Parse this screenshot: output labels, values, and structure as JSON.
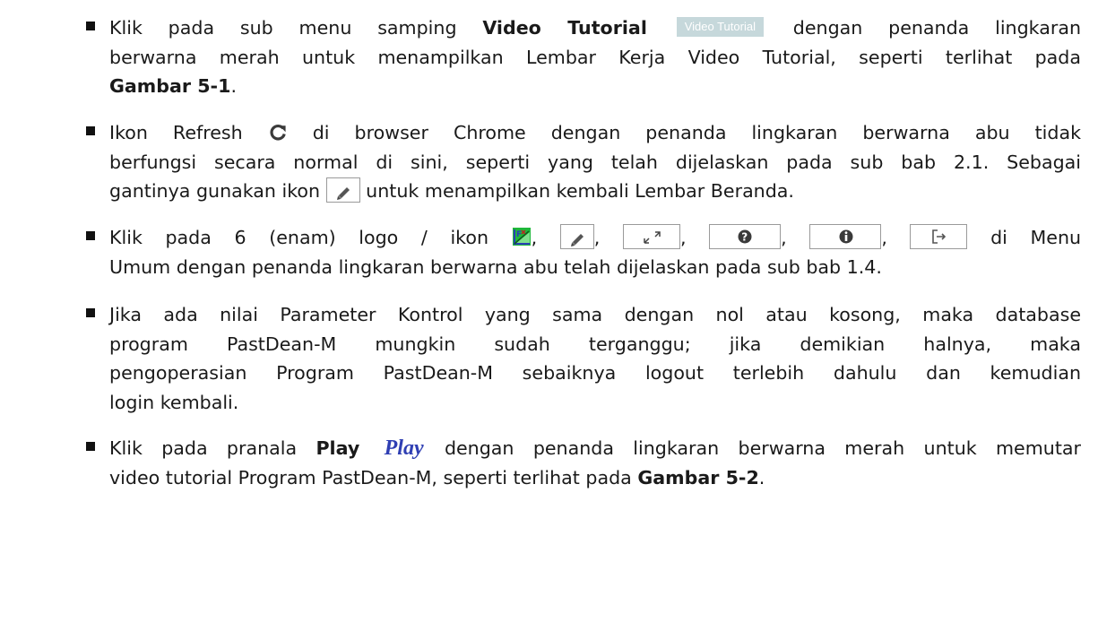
{
  "items": [
    {
      "lines": [
        [
          "Klik pada sub menu samping ",
          {
            "b": "Video Tutorial"
          },
          " ",
          {
            "vt": "video_tutorial_button"
          },
          " dengan penanda lingkaran"
        ],
        [
          "berwarna merah untuk menampilkan Lembar Kerja Video Tutorial, seperti terlihat pada"
        ],
        [
          {
            "b": "Gambar 5-1"
          },
          "."
        ]
      ]
    },
    {
      "lines": [
        [
          "Ikon Refresh ",
          {
            "icon": "refresh"
          },
          " di browser Chrome dengan penanda lingkaran berwarna abu tidak"
        ],
        [
          "berfungsi secara normal di sini, seperti yang telah dijelaskan pada sub bab 2.1.  Sebagai"
        ],
        [
          "gantinya gunakan ikon ",
          {
            "icon": "pencil"
          },
          " untuk menampilkan kembali Lembar Beranda."
        ]
      ]
    },
    {
      "lines": [
        [
          "Klik pada 6 (enam) logo / ikon ",
          {
            "icon": "logo"
          },
          ", ",
          {
            "icon": "pencil"
          },
          ", ",
          {
            "icon": "expand"
          },
          ", ",
          {
            "icon": "question"
          },
          ", ",
          {
            "icon": "info"
          },
          ", ",
          {
            "icon": "logout"
          },
          " di Menu"
        ],
        [
          "Umum  dengan penanda lingkaran berwarna abu telah dijelaskan pada sub bab 1.4."
        ]
      ]
    },
    {
      "lines": [
        [
          "Jika ada nilai Parameter Kontrol yang sama dengan nol atau kosong, maka database"
        ],
        [
          "program PastDean-M mungkin sudah terganggu; jika demikian halnya, maka"
        ],
        [
          "pengoperasian Program PastDean-M sebaiknya logout terlebih dahulu dan kemudian"
        ],
        [
          "login kembali."
        ]
      ]
    },
    {
      "lines": [
        [
          "Klik pada pranala ",
          {
            "b": "Play"
          },
          " ",
          {
            "play": "play_link"
          },
          " dengan penanda lingkaran berwarna merah untuk memutar"
        ],
        [
          "video tutorial Program PastDean-M, seperti terlihat pada ",
          {
            "b": "Gambar 5-2"
          },
          "."
        ]
      ]
    }
  ],
  "inline": {
    "video_tutorial_button": "Video Tutorial",
    "play_link": "Play"
  },
  "icons": {
    "refresh": "refresh-icon",
    "pencil": "pencil-icon",
    "logo": "logo-icon",
    "expand": "expand-icon",
    "question": "question-icon",
    "info": "info-icon",
    "logout": "logout-icon"
  },
  "colors": {
    "video_tutorial_button_bg": "#c6d8db",
    "play_link_text": "#2f3fb3",
    "logo_green": "#1fb83a",
    "logo_blue": "#2a3fb5",
    "refresh_gray": "#3a3a3a"
  }
}
